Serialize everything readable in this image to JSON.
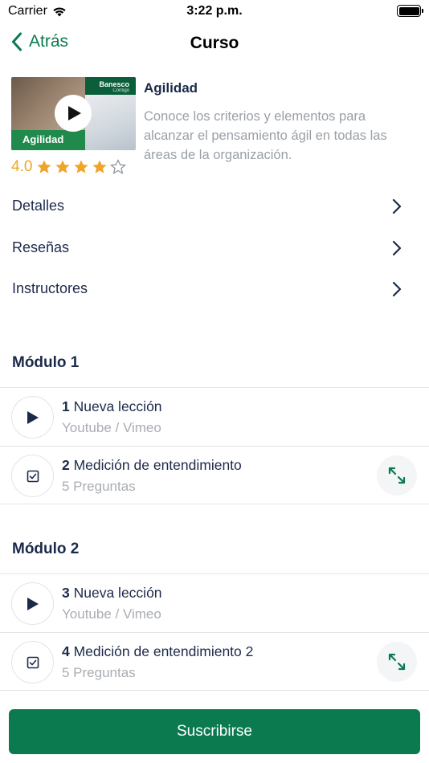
{
  "status_bar": {
    "carrier": "Carrier",
    "time": "3:22 p.m."
  },
  "nav": {
    "back_label": "Atrás",
    "title": "Curso"
  },
  "course": {
    "thumbnail_tag": "Agilidad",
    "thumbnail_brand": "Banesco",
    "thumbnail_brand_sub": "Contigo",
    "rating_value": "4.0",
    "rating_stars": 4,
    "rating_max": 5,
    "title": "Agilidad",
    "description": "Conoce los criterios y elementos para alcanzar el pensamiento ágil en todas las áreas de la organización."
  },
  "links": [
    {
      "label": "Detalles"
    },
    {
      "label": "Reseñas"
    },
    {
      "label": "Instructores"
    }
  ],
  "modules": [
    {
      "title": "Módulo 1",
      "lessons": [
        {
          "number": "1",
          "title": "Nueva lección",
          "subtitle": "Youtube / Vimeo",
          "icon": "play-icon"
        },
        {
          "number": "2",
          "title": "Medición de entendimiento",
          "subtitle": "5 Preguntas",
          "icon": "checkbox-icon",
          "expand_icon": "expand-icon"
        }
      ]
    },
    {
      "title": "Módulo 2",
      "lessons": [
        {
          "number": "3",
          "title": "Nueva lección",
          "subtitle": "Youtube / Vimeo",
          "icon": "play-icon"
        },
        {
          "number": "4",
          "title": "Medición de entendimiento 2",
          "subtitle": "5 Preguntas",
          "icon": "checkbox-icon",
          "expand_icon": "expand-icon"
        }
      ]
    }
  ],
  "subscribe_label": "Suscribirse",
  "colors": {
    "brand_green": "#0b7a4f",
    "star": "#f0a52a",
    "navy_text": "#1c2a4a"
  }
}
